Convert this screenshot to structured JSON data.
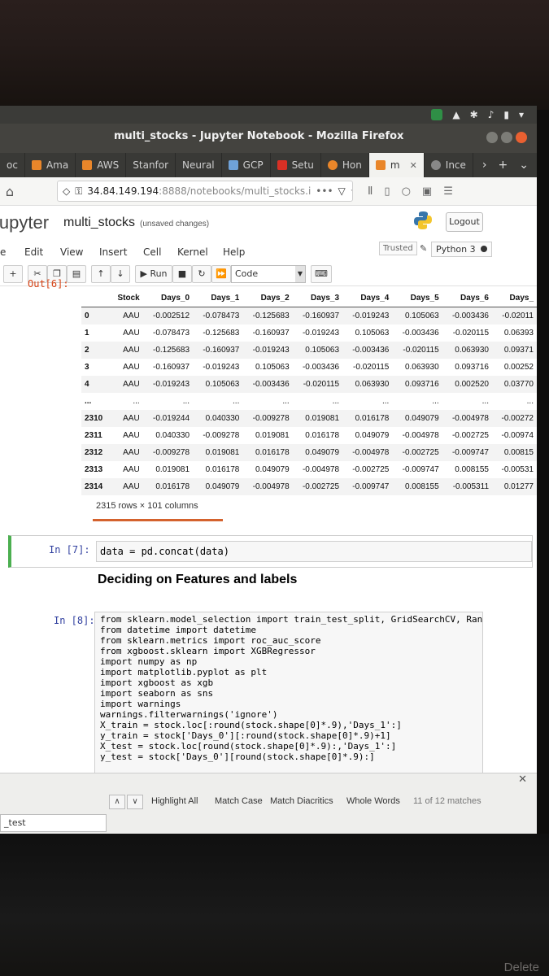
{
  "window": {
    "title": "multi_stocks - Jupyter Notebook - Mozilla Firefox"
  },
  "tabs": [
    {
      "label": "oc",
      "active": false
    },
    {
      "label": "Ama",
      "active": false
    },
    {
      "label": "AWS",
      "active": false
    },
    {
      "label": "Stanfor",
      "active": false
    },
    {
      "label": "Neural",
      "active": false
    },
    {
      "label": "GCP",
      "active": false
    },
    {
      "label": "Setu",
      "active": false
    },
    {
      "label": "Hon",
      "active": false
    },
    {
      "label": "m",
      "active": true
    },
    {
      "label": "Ince",
      "active": false
    }
  ],
  "urlbar": {
    "host": "34.84.149.194",
    "path": ":8888/notebooks/multi_stocks.i",
    "page_actions": "•••"
  },
  "jupyter": {
    "logo_text": "jupyter",
    "notebook_name": "multi_stocks",
    "save_status": "(unsaved changes)",
    "logout_label": "Logout",
    "trusted_label": "Trusted",
    "kernel_label": "Python 3"
  },
  "menu": {
    "items": [
      "e",
      "Edit",
      "View",
      "Insert",
      "Cell",
      "Kernel",
      "Help"
    ]
  },
  "toolbar": {
    "run_label": "Run",
    "cell_type": "Code"
  },
  "output6": {
    "prompt": "Out[6]:",
    "columns": [
      "",
      "Stock",
      "Days_0",
      "Days_1",
      "Days_2",
      "Days_3",
      "Days_4",
      "Days_5",
      "Days_6",
      "Days_"
    ],
    "rows": [
      [
        "0",
        "AAU",
        "-0.002512",
        "-0.078473",
        "-0.125683",
        "-0.160937",
        "-0.019243",
        "0.105063",
        "-0.003436",
        "-0.02011"
      ],
      [
        "1",
        "AAU",
        "-0.078473",
        "-0.125683",
        "-0.160937",
        "-0.019243",
        "0.105063",
        "-0.003436",
        "-0.020115",
        "0.06393"
      ],
      [
        "2",
        "AAU",
        "-0.125683",
        "-0.160937",
        "-0.019243",
        "0.105063",
        "-0.003436",
        "-0.020115",
        "0.063930",
        "0.09371"
      ],
      [
        "3",
        "AAU",
        "-0.160937",
        "-0.019243",
        "0.105063",
        "-0.003436",
        "-0.020115",
        "0.063930",
        "0.093716",
        "0.00252"
      ],
      [
        "4",
        "AAU",
        "-0.019243",
        "0.105063",
        "-0.003436",
        "-0.020115",
        "0.063930",
        "0.093716",
        "0.002520",
        "0.03770"
      ],
      [
        "...",
        "...",
        "...",
        "...",
        "...",
        "...",
        "...",
        "...",
        "...",
        "..."
      ],
      [
        "2310",
        "AAU",
        "-0.019244",
        "0.040330",
        "-0.009278",
        "0.019081",
        "0.016178",
        "0.049079",
        "-0.004978",
        "-0.00272"
      ],
      [
        "2311",
        "AAU",
        "0.040330",
        "-0.009278",
        "0.019081",
        "0.016178",
        "0.049079",
        "-0.004978",
        "-0.002725",
        "-0.00974"
      ],
      [
        "2312",
        "AAU",
        "-0.009278",
        "0.019081",
        "0.016178",
        "0.049079",
        "-0.004978",
        "-0.002725",
        "-0.009747",
        "0.00815"
      ],
      [
        "2313",
        "AAU",
        "0.019081",
        "0.016178",
        "0.049079",
        "-0.004978",
        "-0.002725",
        "-0.009747",
        "0.008155",
        "-0.00531"
      ],
      [
        "2314",
        "AAU",
        "0.016178",
        "0.049079",
        "-0.004978",
        "-0.002725",
        "-0.009747",
        "0.008155",
        "-0.005311",
        "0.01277"
      ]
    ],
    "shape": "2315 rows × 101 columns"
  },
  "cell7": {
    "prompt": "In [7]:",
    "code": "data = pd.concat(data)"
  },
  "markdown": {
    "heading": "Deciding on Features and labels"
  },
  "cell8": {
    "prompt": "In [8]:",
    "lines": [
      "from sklearn.model_selection import train_test_split, GridSearchCV, Ran",
      "from datetime import datetime",
      "from sklearn.metrics import roc_auc_score",
      "from xgboost.sklearn import XGBRegressor",
      "import numpy as np",
      "import matplotlib.pyplot as plt",
      "import xgboost as xgb",
      "import seaborn as sns",
      "import warnings",
      "",
      "warnings.filterwarnings('ignore')",
      "",
      "X_train = stock.loc[:round(stock.shape[0]*.9),'Days_1':]",
      "y_train = stock['Days_0'][:round(stock.shape[0]*.9)+1]",
      "X_test = stock.loc[round(stock.shape[0]*.9):,'Days_1':]",
      "y_test = stock['Days_0'][round(stock.shape[0]*.9):]"
    ]
  },
  "findbar": {
    "input_value": "_test",
    "highlight_all": "Highlight All",
    "match_case": "Match Case",
    "match_diacritics": "Match Diacritics",
    "whole_words": "Whole Words",
    "status": "11 of 12 matches"
  },
  "keyboard": {
    "key_label": "Delete"
  }
}
